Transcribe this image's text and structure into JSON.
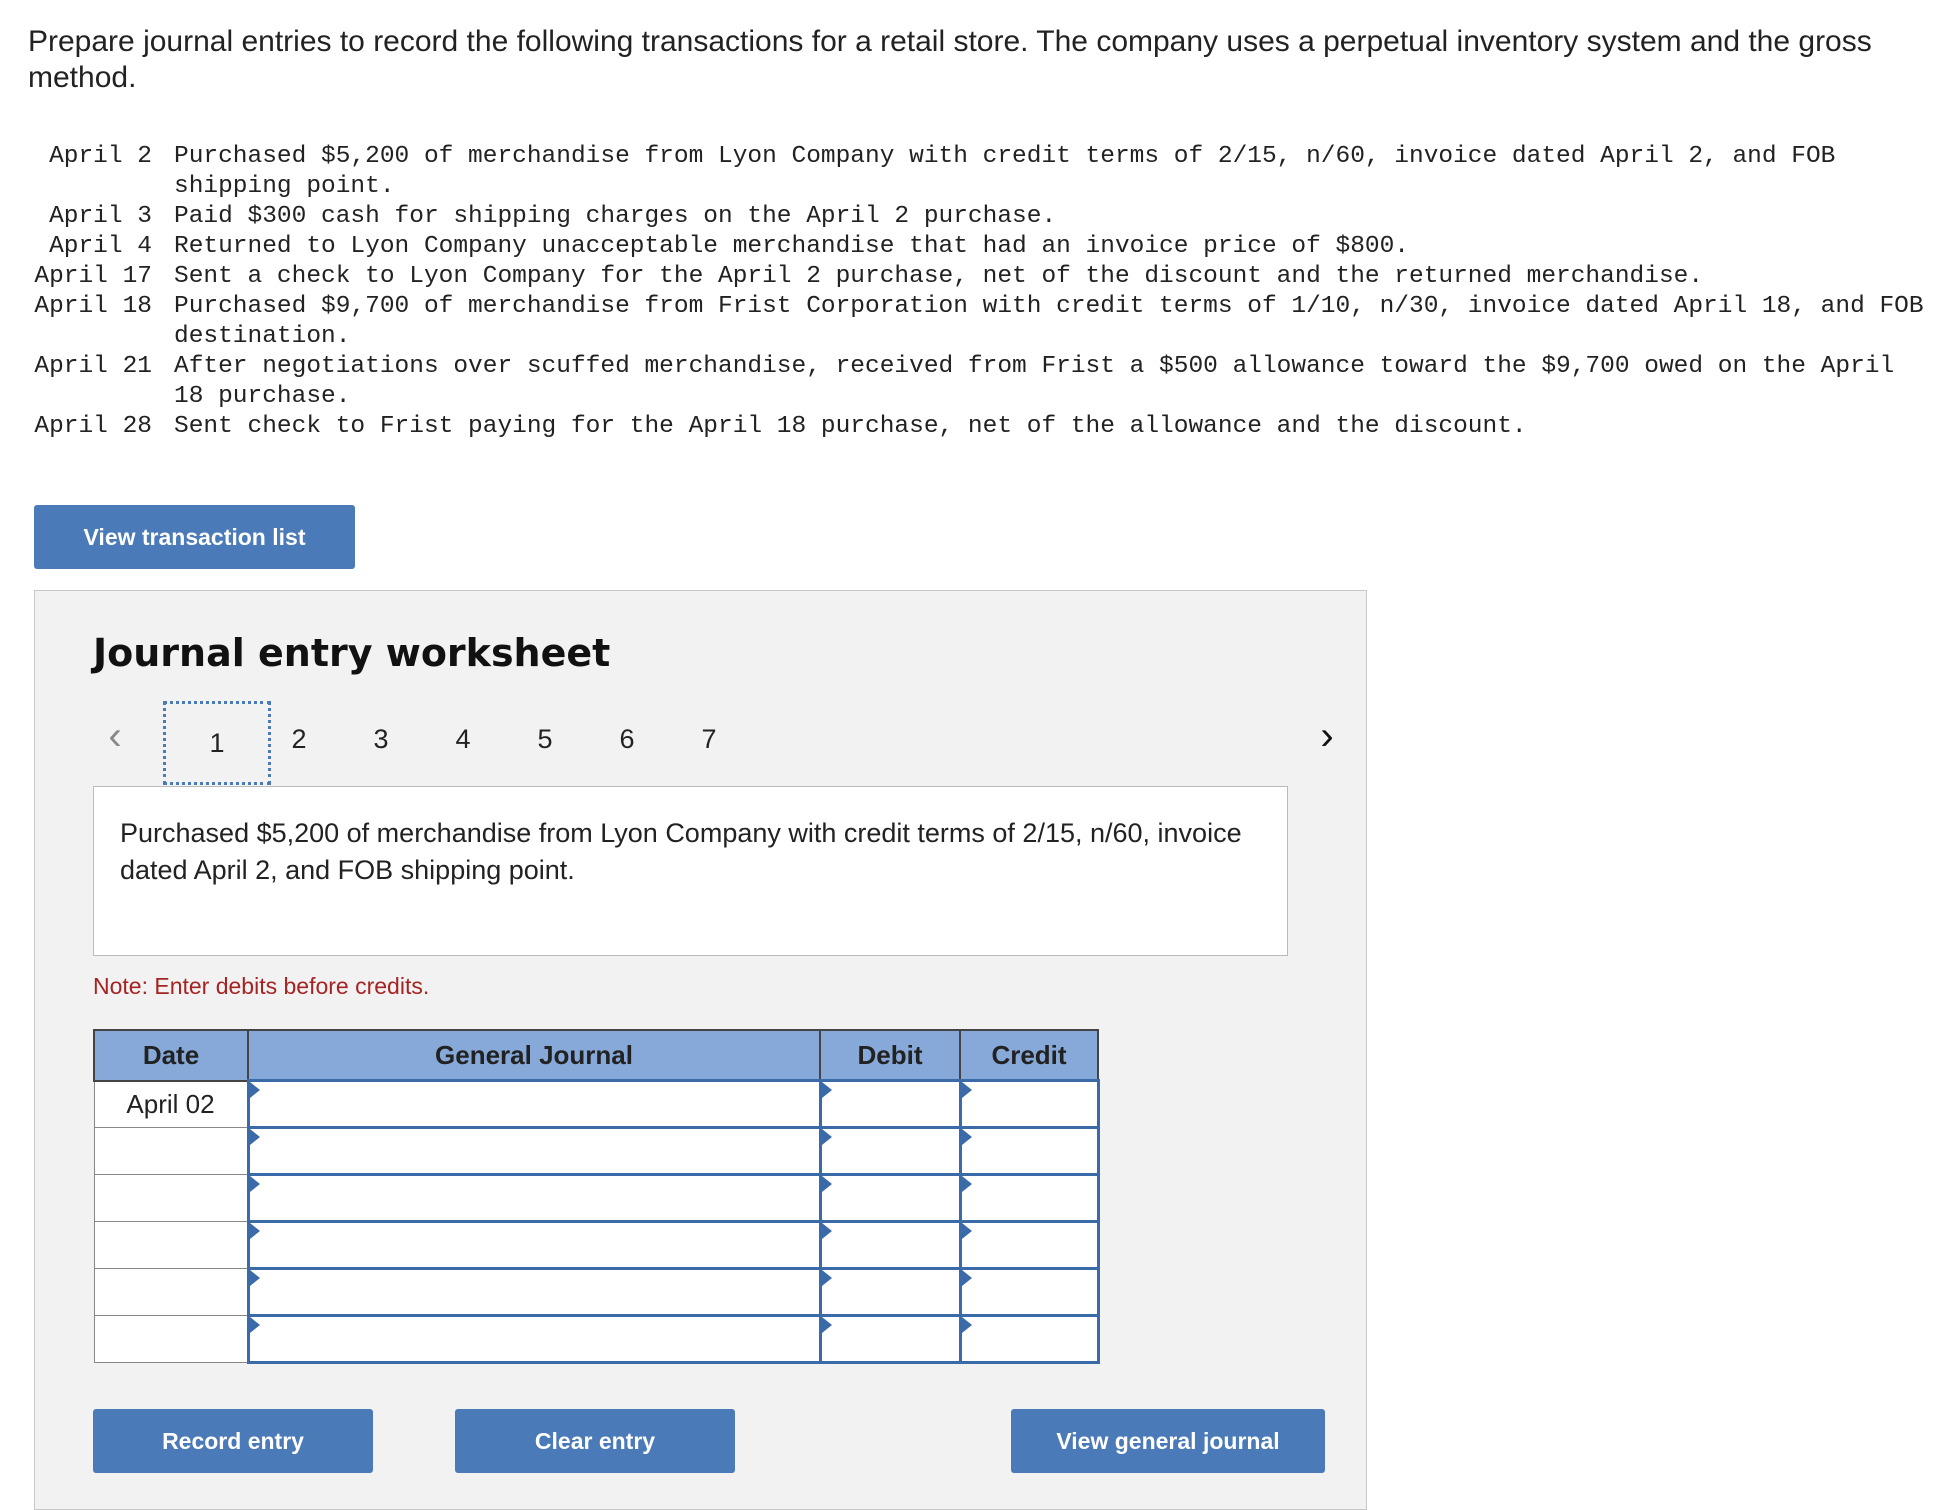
{
  "intro": "Prepare journal entries to record the following transactions for a retail store. The company uses a perpetual inventory system and the gross method.",
  "transactions": [
    {
      "date": "April 2",
      "text": "Purchased $5,200 of merchandise from Lyon Company with credit terms of 2/15, n/60, invoice dated April 2, and FOB shipping point."
    },
    {
      "date": "April 3",
      "text": "Paid $300 cash for shipping charges on the April 2 purchase."
    },
    {
      "date": "April 4",
      "text": "Returned to Lyon Company unacceptable merchandise that had an invoice price of $800."
    },
    {
      "date": "April 17",
      "text": "Sent a check to Lyon Company for the April 2 purchase, net of the discount and the returned merchandise."
    },
    {
      "date": "April 18",
      "text": "Purchased $9,700 of merchandise from Frist Corporation with credit terms of 1/10, n/30, invoice dated April 18, and FOB destination."
    },
    {
      "date": "April 21",
      "text": "After negotiations over scuffed merchandise, received from Frist a $500 allowance toward the $9,700 owed on the April 18 purchase."
    },
    {
      "date": "April 28",
      "text": "Sent check to Frist paying for the April 18 purchase, net of the allowance and the discount."
    }
  ],
  "buttons": {
    "view_transaction_list": "View transaction list",
    "record_entry": "Record entry",
    "clear_entry": "Clear entry",
    "view_general_journal": "View general journal"
  },
  "worksheet": {
    "title": "Journal entry worksheet",
    "pages": [
      "1",
      "2",
      "3",
      "4",
      "5",
      "6",
      "7"
    ],
    "active_page": "1",
    "prev_icon": "‹",
    "next_icon": "›",
    "description": "Purchased $5,200 of merchandise from Lyon Company with credit terms of 2/15, n/60, invoice dated April 2, and FOB shipping point.",
    "note": "Note: Enter debits before credits."
  },
  "journal": {
    "headers": {
      "date": "Date",
      "general_journal": "General Journal",
      "debit": "Debit",
      "credit": "Credit"
    },
    "rows": [
      {
        "date": "April 02",
        "account": "",
        "debit": "",
        "credit": ""
      },
      {
        "date": "",
        "account": "",
        "debit": "",
        "credit": ""
      },
      {
        "date": "",
        "account": "",
        "debit": "",
        "credit": ""
      },
      {
        "date": "",
        "account": "",
        "debit": "",
        "credit": ""
      },
      {
        "date": "",
        "account": "",
        "debit": "",
        "credit": ""
      },
      {
        "date": "",
        "account": "",
        "debit": "",
        "credit": ""
      }
    ]
  },
  "colors": {
    "button_bg": "#4a7ab8",
    "table_header_bg": "#87a9d9",
    "note_text": "#a62323",
    "panel_bg": "#f2f2f2"
  }
}
